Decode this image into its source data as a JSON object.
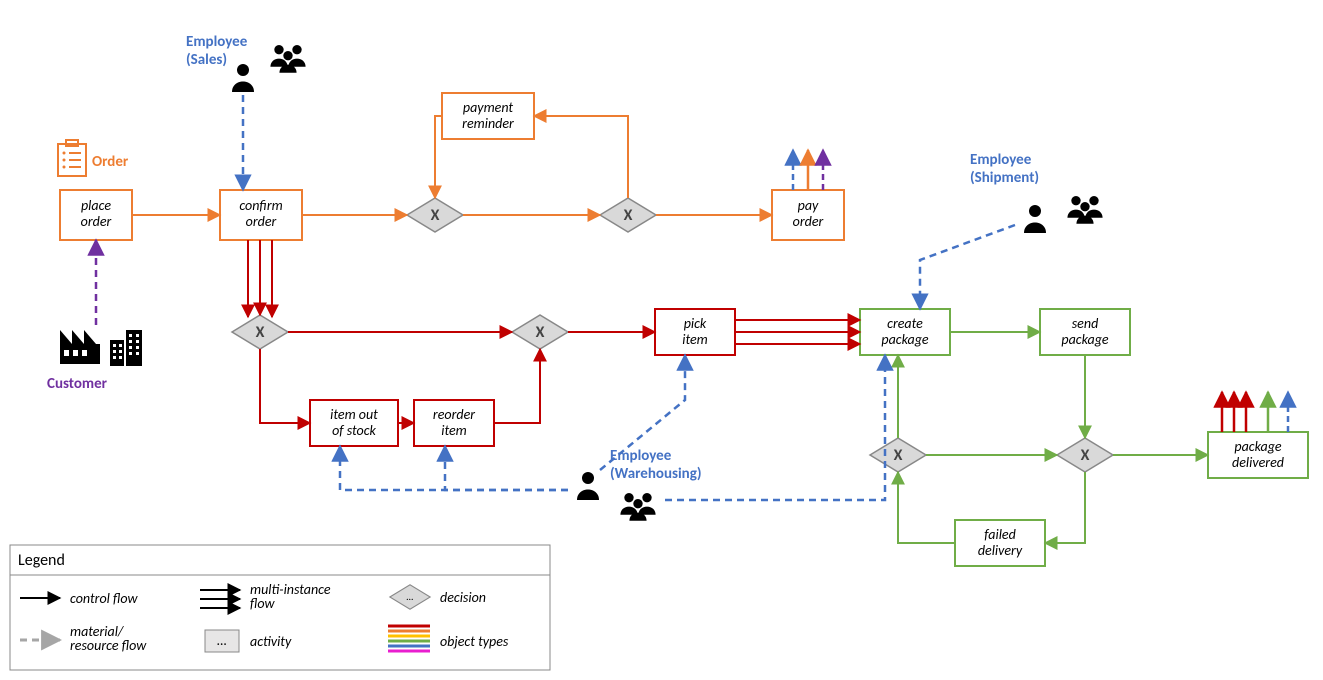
{
  "roles": {
    "customer": "Customer",
    "sales": "Employee\n(Sales)",
    "warehousing": "Employee\n(Warehousing)",
    "shipment": "Employee\n(Shipment)",
    "order": "Order"
  },
  "activities": {
    "place_order": "place\norder",
    "confirm_order": "confirm\norder",
    "payment_reminder": "payment\nreminder",
    "pay_order": "pay\norder",
    "item_out_of_stock": "item out\nof stock",
    "reorder_item": "reorder\nitem",
    "pick_item": "pick\nitem",
    "create_package": "create\npackage",
    "send_package": "send\npackage",
    "failed_delivery": "failed\ndelivery",
    "package_delivered": "package\ndelivered"
  },
  "gateway_label": "X",
  "legend": {
    "title": "Legend",
    "control_flow": "control flow",
    "material_flow": "material/\nresource flow",
    "multi_instance": "multi-instance\nflow",
    "activity": "activity",
    "decision": "decision",
    "object_types": "object types"
  },
  "colors": {
    "orange": "#ed7d31",
    "red": "#c00000",
    "green": "#70ad47",
    "blue": "#4472c4",
    "purple": "#7030a0",
    "gray": "#a6a6a6",
    "black": "#000000"
  }
}
